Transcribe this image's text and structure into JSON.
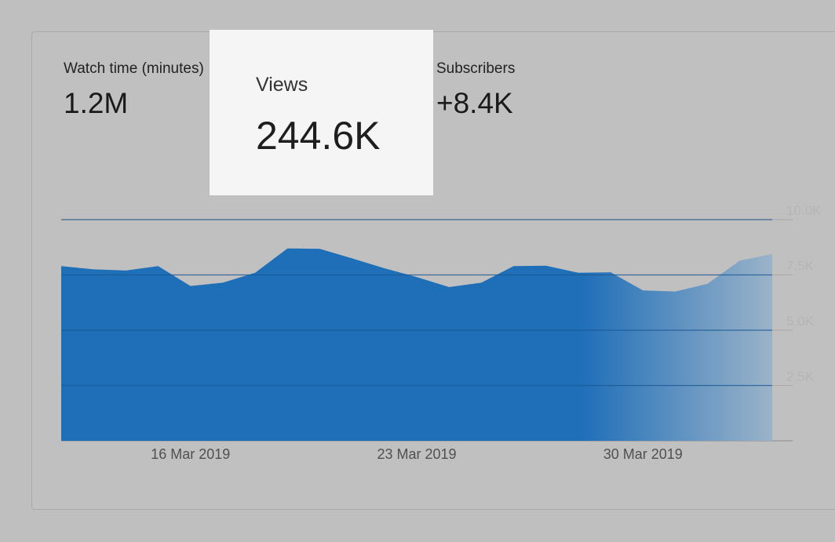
{
  "metrics": [
    {
      "label": "Watch time (minutes)",
      "value": "1.2M"
    },
    {
      "label": "Views",
      "value": "244.6K"
    },
    {
      "label": "Subscribers",
      "value": "+8.4K"
    }
  ],
  "chart_data": {
    "type": "area",
    "title": "",
    "xlabel": "",
    "ylabel": "",
    "x_tick_labels": [
      "16 Mar 2019",
      "23 Mar 2019",
      "30 Mar 2019"
    ],
    "y_tick_labels": [
      "10.0K",
      "7.5K",
      "5.0K",
      "2.5K"
    ],
    "ylim": [
      0,
      10000
    ],
    "grid": true,
    "x": [
      "12 Mar 2019",
      "13 Mar 2019",
      "14 Mar 2019",
      "15 Mar 2019",
      "16 Mar 2019",
      "17 Mar 2019",
      "18 Mar 2019",
      "19 Mar 2019",
      "20 Mar 2019",
      "21 Mar 2019",
      "22 Mar 2019",
      "23 Mar 2019",
      "24 Mar 2019",
      "25 Mar 2019",
      "26 Mar 2019",
      "27 Mar 2019",
      "28 Mar 2019",
      "29 Mar 2019",
      "30 Mar 2019",
      "31 Mar 2019",
      "1 Apr 2019",
      "2 Apr 2019",
      "3 Apr 2019"
    ],
    "series": [
      {
        "values": [
          7900,
          7750,
          7700,
          7900,
          7000,
          7150,
          7600,
          8700,
          8680,
          8250,
          7800,
          7400,
          6950,
          7150,
          7900,
          7920,
          7600,
          7620,
          6800,
          6750,
          7100,
          8150,
          8450
        ],
        "color": "#1e6eb8"
      }
    ]
  }
}
